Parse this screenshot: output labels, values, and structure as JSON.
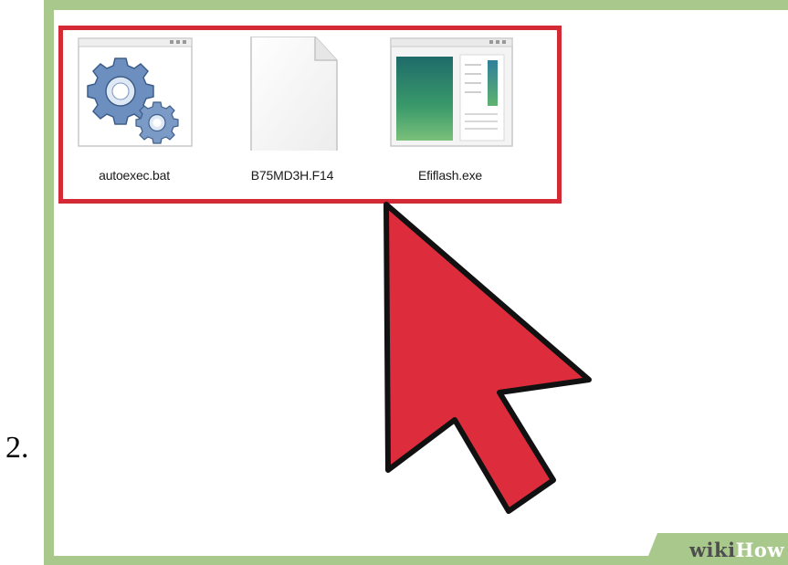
{
  "step": {
    "number": "2."
  },
  "files": [
    {
      "name": "autoexec.bat",
      "icon": "settings-gears-icon"
    },
    {
      "name": "B75MD3H.F14",
      "icon": "blank-document-icon"
    },
    {
      "name": "Efiflash.exe",
      "icon": "application-window-icon"
    }
  ],
  "watermark": {
    "part1": "wiki",
    "part2": "How"
  },
  "colors": {
    "frame_green": "#a9c98c",
    "selection_red": "#d32a36",
    "cursor_red": "#dd2d3c",
    "cursor_outline": "#111111"
  },
  "cursor": {
    "icon": "mouse-pointer-arrow-icon"
  }
}
